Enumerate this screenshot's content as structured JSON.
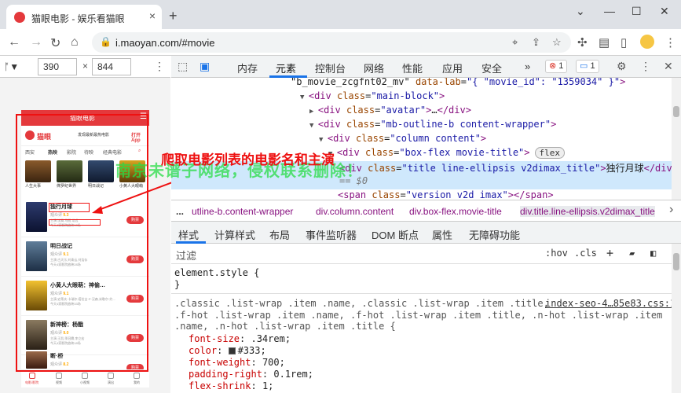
{
  "browser": {
    "tab_title": "猫眼电影 - 娱乐看猫眼",
    "tab_close": "×",
    "new_tab": "+",
    "window_controls": [
      "⌄",
      "—",
      "☐",
      "✕"
    ],
    "url": "i.maoyan.com/#movie"
  },
  "device_toolbar": {
    "device_label": "ᚩ▼",
    "width": "390",
    "height": "844",
    "times": "×",
    "more": "⋮"
  },
  "phone": {
    "topbar_title": "猫眼电影",
    "brand": "猫眼",
    "slogan": "发现最新最热电影",
    "app_link": "打开App",
    "tabs": [
      "西安",
      "热映",
      "影院",
      "待映",
      "经典电影"
    ],
    "posters": [
      {
        "caption": "人生大事"
      },
      {
        "caption": "侏罗纪世界"
      },
      {
        "caption": "明日战记"
      },
      {
        "caption": "小黄人大眼萌"
      }
    ],
    "movies": [
      {
        "name": "独行月球",
        "score_label": "观众评",
        "score": "9.3",
        "meta": "主演:沈腾,马丽,常远",
        "meta2": "今天4家影院放映90场",
        "buy": "购票"
      },
      {
        "name": "明日战记",
        "score_label": "观众评",
        "score": "9.1",
        "meta": "主演:古天乐,刘青云,刘浩存",
        "meta2": "今天4家影院放映28场",
        "buy": "购票"
      },
      {
        "name": "小黄人大眼萌：神偷…",
        "score_label": "观众评",
        "score": "9.1",
        "meta": "主演:史蒂夫·卡瑞尔,塔拉吉·P·汉森,米歇尔·约…",
        "meta2": "今天4家影院放映33场",
        "buy": "购票"
      },
      {
        "name": "新神榜：杨戬",
        "score_label": "观众评",
        "score": "9.0",
        "meta": "主演:王凯,季冠霖,李立宏",
        "meta2": "今天4家影院放映18场",
        "buy": "购票"
      },
      {
        "name": "断·桥",
        "score_label": "观众评",
        "score": "8.2",
        "meta": "",
        "meta2": "",
        "buy": "购票"
      }
    ],
    "footer": [
      "电影/影院",
      "视频",
      "小视频",
      "演出",
      "我的"
    ]
  },
  "devtools": {
    "tabs": [
      "内存",
      "元素",
      "控制台",
      "网络",
      "性能",
      "应用",
      "安全"
    ],
    "more_tabs": "»",
    "errors": "1",
    "messages": "1",
    "elements_lines": [
      {
        "indent": 0,
        "tri": "",
        "html": [
          {
            "t": "tx",
            "v": "\"b_movie_zcgfnt02_mv\" "
          },
          {
            "t": "at",
            "v": "data-lab"
          },
          {
            "t": "tx",
            "v": "="
          },
          {
            "t": "av",
            "v": "\"{ \"movie_id\": \"1359034\" }\""
          },
          {
            "t": "tg",
            "v": ">"
          }
        ]
      },
      {
        "indent": 1,
        "tri": "▼",
        "html": [
          {
            "t": "tg",
            "v": "<div "
          },
          {
            "t": "at",
            "v": "class"
          },
          {
            "t": "tx",
            "v": "="
          },
          {
            "t": "av",
            "v": "\"main-block\""
          },
          {
            "t": "tg",
            "v": ">"
          }
        ]
      },
      {
        "indent": 2,
        "tri": "▶",
        "html": [
          {
            "t": "tg",
            "v": "<div "
          },
          {
            "t": "at",
            "v": "class"
          },
          {
            "t": "tx",
            "v": "="
          },
          {
            "t": "av",
            "v": "\"avatar\""
          },
          {
            "t": "tg",
            "v": ">"
          },
          {
            "t": "tx",
            "v": "…"
          },
          {
            "t": "tg",
            "v": "</div>"
          }
        ]
      },
      {
        "indent": 2,
        "tri": "▼",
        "html": [
          {
            "t": "tg",
            "v": "<div "
          },
          {
            "t": "at",
            "v": "class"
          },
          {
            "t": "tx",
            "v": "="
          },
          {
            "t": "av",
            "v": "\"mb-outline-b content-wrapper\""
          },
          {
            "t": "tg",
            "v": ">"
          }
        ]
      },
      {
        "indent": 3,
        "tri": "▼",
        "html": [
          {
            "t": "tg",
            "v": "<div "
          },
          {
            "t": "at",
            "v": "class"
          },
          {
            "t": "tx",
            "v": "="
          },
          {
            "t": "av",
            "v": "\"column content\""
          },
          {
            "t": "tg",
            "v": ">"
          }
        ]
      },
      {
        "indent": 4,
        "tri": "▼",
        "html": [
          {
            "t": "tg",
            "v": "<div "
          },
          {
            "t": "at",
            "v": "class"
          },
          {
            "t": "tx",
            "v": "="
          },
          {
            "t": "av",
            "v": "\"box-flex movie-title\""
          },
          {
            "t": "tg",
            "v": ">"
          },
          {
            "t": "fl",
            "v": "flex"
          }
        ]
      },
      {
        "indent": 5,
        "tri": "",
        "sel": true,
        "html": [
          {
            "t": "tg",
            "v": "<div "
          },
          {
            "t": "at",
            "v": "class"
          },
          {
            "t": "tx",
            "v": "="
          },
          {
            "t": "av",
            "v": "\"title line-ellipsis v2dimax_title\""
          },
          {
            "t": "tg",
            "v": ">"
          },
          {
            "t": "tx",
            "v": "独行月球"
          },
          {
            "t": "tg",
            "v": "</div>"
          }
        ]
      },
      {
        "indent": 5,
        "tri": "",
        "sel": true,
        "html": [
          {
            "t": "tx",
            "v": "== $0"
          }
        ]
      },
      {
        "indent": 5,
        "tri": "",
        "html": [
          {
            "t": "tg",
            "v": "<span "
          },
          {
            "t": "at",
            "v": "class"
          },
          {
            "t": "tx",
            "v": "="
          },
          {
            "t": "av",
            "v": "\"version v2d imax\""
          },
          {
            "t": "tg",
            "v": "></span>"
          }
        ]
      }
    ],
    "breadcrumbs": [
      "...",
      "utline-b.content-wrapper",
      "div.column.content",
      "div.box-flex.movie-title",
      "div.title.line-ellipsis.v2dimax_title"
    ],
    "style_tabs": [
      "样式",
      "计算样式",
      "布局",
      "事件监听器",
      "DOM 断点",
      "属性",
      "无障碍功能"
    ],
    "filter_placeholder": "过滤",
    "filter_hov": ":hov",
    "filter_cls": ".cls",
    "filter_plus": "+",
    "styles": {
      "element_style": "element.style {",
      "close_brace": "}",
      "source": "index-seo-4…85e83.css:1",
      "selector_lines": [
        ".classic .list-wrap .item .name, .classic .list-wrap .item .title,",
        ".f-hot .list-wrap .item .name, .f-hot .list-wrap .item .title, .n-hot .list-wrap .item",
        ".name, .n-hot .list-wrap .item .title {"
      ],
      "declarations": [
        {
          "prop": "font-size",
          "val": ".34rem;"
        },
        {
          "prop": "color",
          "val": "#333;"
        },
        {
          "prop": "font-weight",
          "val": "700;"
        },
        {
          "prop": "padding-right",
          "val": "0.1rem;"
        },
        {
          "prop": "flex-shrink",
          "val": "1;"
        }
      ]
    }
  },
  "annotation_text": "爬取电影列表的电影名和主演",
  "watermark_text": "南京未谱子网络，侵权联系删除！",
  "colors": {
    "brand_red": "#e4393c",
    "annotation_red": "#ee1111",
    "selection_blue": "#cfe8fc",
    "accent_blue": "#1a73e8"
  }
}
